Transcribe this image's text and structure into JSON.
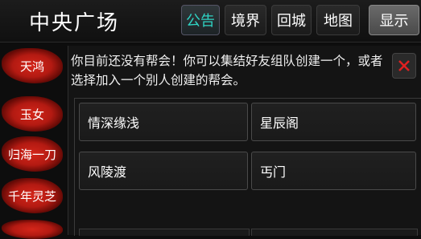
{
  "header": {
    "title": "中央广场",
    "nav": [
      "公告",
      "境界",
      "回城",
      "地图"
    ],
    "active_nav": "公告",
    "show_button": "显示"
  },
  "sidebar": {
    "items": [
      "天鸿",
      "玉女",
      "归海一刀",
      "千年灵芝"
    ]
  },
  "panel": {
    "message": "你目前还没有帮会！你可以集结好友组队创建一个，或者选择加入一个别人创建的帮会。",
    "guilds": [
      "情深缘浅",
      "星辰阁",
      "风陵渡",
      "丐门"
    ]
  },
  "colors": {
    "active_nav": "#2fd3c4",
    "sidebar_red": "#c8221a",
    "background": "#0d0d0d"
  }
}
